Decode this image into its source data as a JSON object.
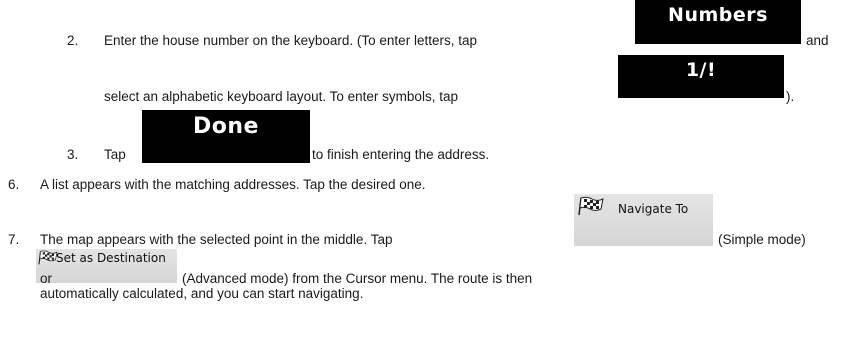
{
  "steps": {
    "s2_num": "2.",
    "s2_a": "Enter the house number on the keyboard. (To enter letters, tap",
    "s2_and": "and",
    "s2_b": "select an alphabetic keyboard layout. To enter symbols, tap",
    "s2_end": ").",
    "s3_num": "3.",
    "s3_tap": "Tap",
    "s3_b": "to finish entering the address.",
    "s6_num": "6.",
    "s6_text": "A list appears with the matching addresses. Tap the desired one.",
    "s7_num": "7.",
    "s7_a": "The map appears with the selected point in the middle. Tap",
    "s7_simple": "(Simple mode)",
    "s7_or": "or",
    "s7_adv": "(Advanced mode) from the Cursor menu. The route is then",
    "s7_c": "automatically calculated, and you can start navigating."
  },
  "buttons": {
    "numbers": "Numbers",
    "symbols": "1/!",
    "done": "Done",
    "navigate_to": "Navigate To",
    "set_as_destination": "Set as Destination"
  },
  "icons": {
    "navigate_flag": "checkered-flag-icon",
    "destination_flag": "checkered-flag-icon"
  }
}
